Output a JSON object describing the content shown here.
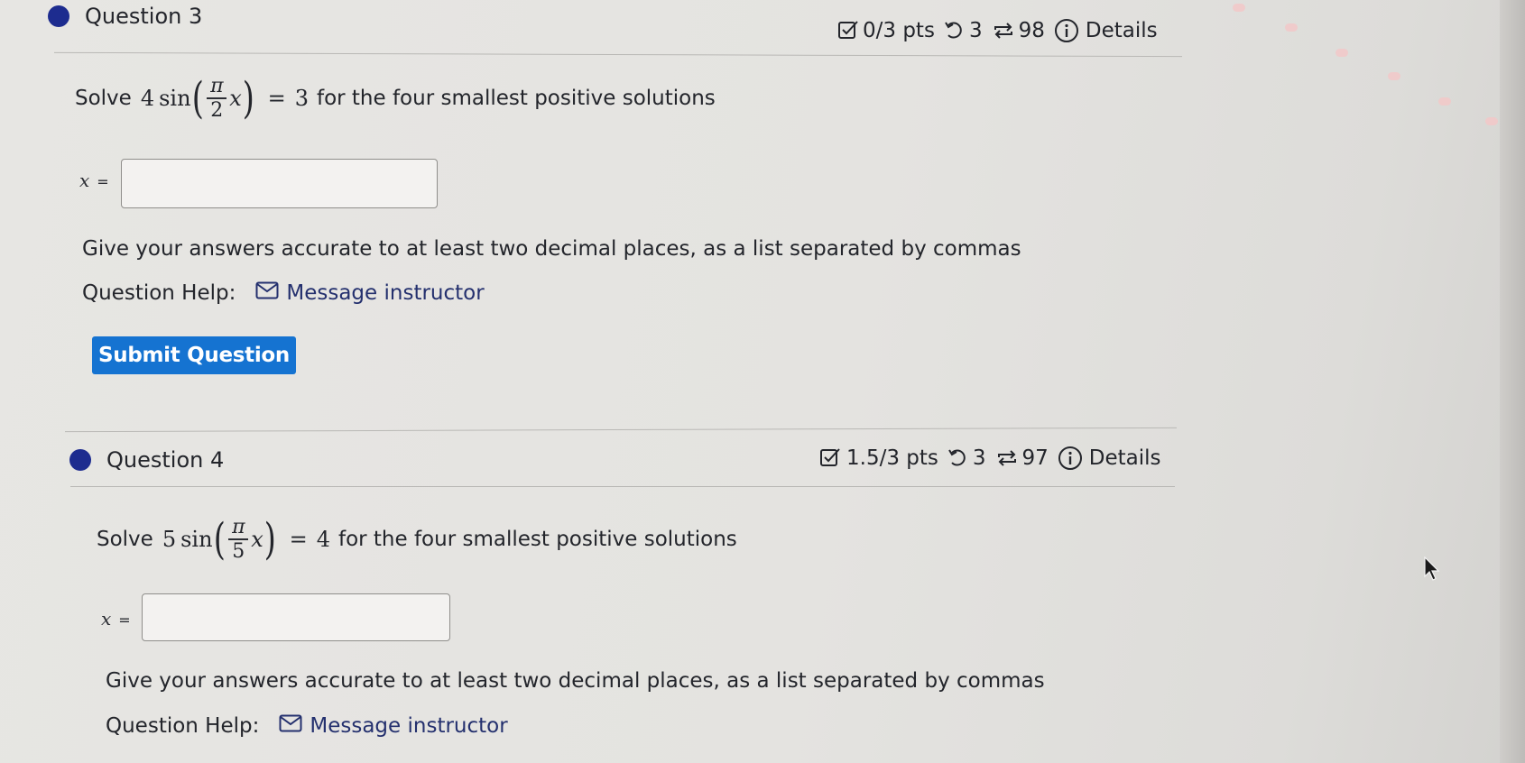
{
  "colors": {
    "accent_dot": "#1d2c8f",
    "submit_button": "#1573d1",
    "link": "#24306e",
    "text": "#23252b",
    "page_background": "#e5e4e1"
  },
  "questions": [
    {
      "title": "Question 3",
      "score": "0/3 pts",
      "tries": "3",
      "retakes": "98",
      "details": "Details",
      "prompt_prefix": "Solve",
      "equation": {
        "coef": "4",
        "func": "sin",
        "frac_num": "π",
        "frac_den": "2",
        "var": "x",
        "rhs": "3"
      },
      "prompt_suffix": "for the four smallest positive solutions",
      "answer_label": "x",
      "answer_eq": "=",
      "answer_value": "",
      "instructions": "Give your answers accurate to at least two decimal places, as a list separated by commas",
      "help_label": "Question Help:",
      "help_link": "Message instructor",
      "submit_label": "Submit Question"
    },
    {
      "title": "Question 4",
      "score": "1.5/3 pts",
      "tries": "3",
      "retakes": "97",
      "details": "Details",
      "prompt_prefix": "Solve",
      "equation": {
        "coef": "5",
        "func": "sin",
        "frac_num": "π",
        "frac_den": "5",
        "var": "x",
        "rhs": "4"
      },
      "prompt_suffix": "for the four smallest positive solutions",
      "answer_label": "x",
      "answer_eq": "=",
      "answer_value": "",
      "instructions": "Give your answers accurate to at least two decimal places, as a list separated by commas",
      "help_label": "Question Help:",
      "help_link": "Message instructor"
    }
  ],
  "icons": {
    "score": "checkbox-pencil-icon",
    "tries": "undo-icon",
    "retakes": "repeat-icon",
    "details": "info-circle-icon",
    "message": "envelope-icon",
    "cursor": "mouse-pointer-icon"
  }
}
